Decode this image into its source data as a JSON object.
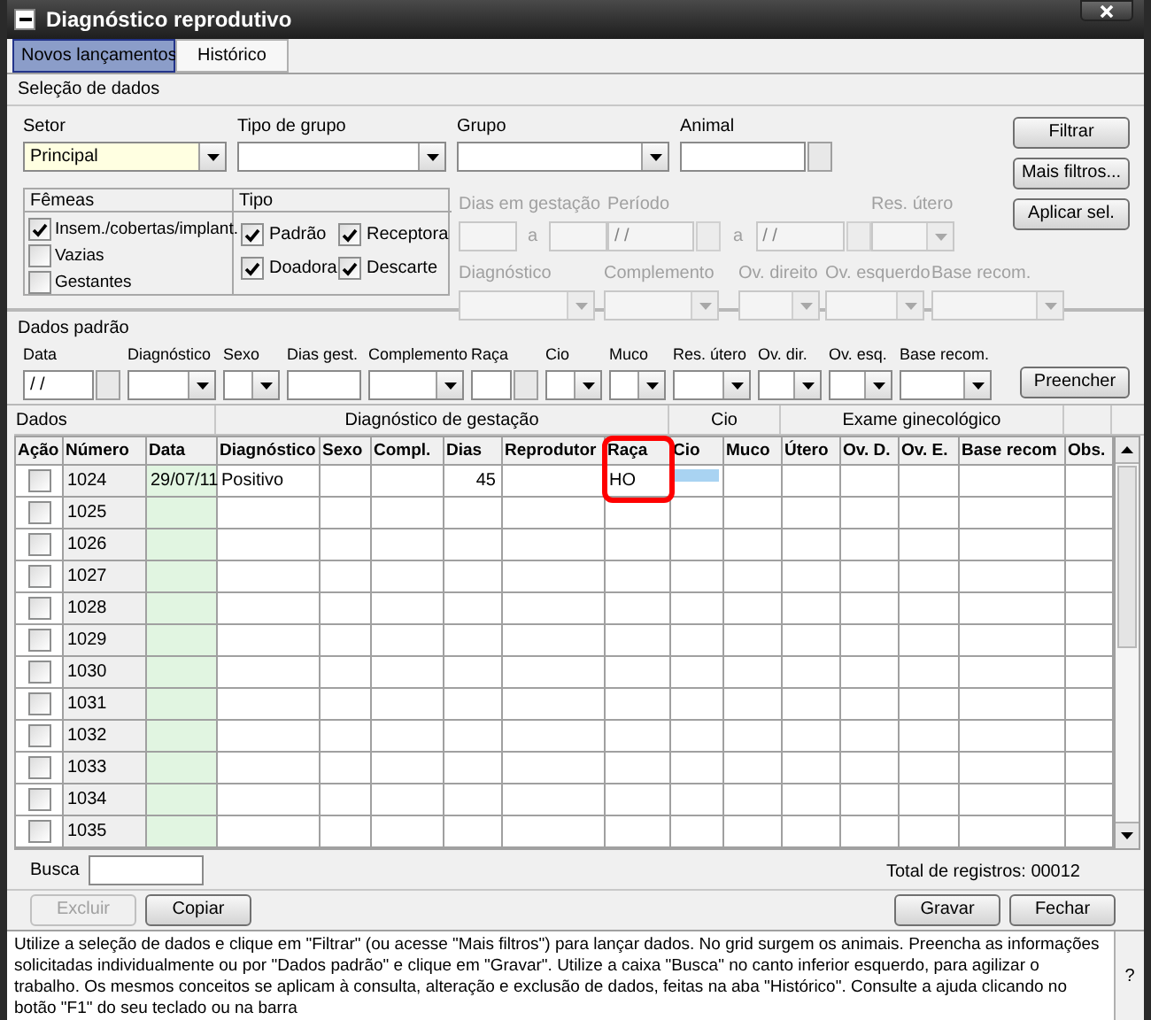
{
  "window": {
    "title": "Diagnóstico reprodutivo"
  },
  "tabs": [
    {
      "label": "Novos lançamentos",
      "selected": true
    },
    {
      "label": "Histórico",
      "selected": false
    }
  ],
  "selection": {
    "title": "Seleção de dados",
    "fields": [
      {
        "label": "Setor",
        "kind": "combo",
        "value": "Principal",
        "focused": true
      },
      {
        "label": "Tipo de grupo",
        "kind": "combo",
        "focused": false
      },
      {
        "label": "Grupo",
        "kind": "combo",
        "focused": false
      },
      {
        "label": "Animal",
        "kind": "lookup",
        "focused": false
      }
    ],
    "femeas": {
      "title": "Fêmeas",
      "items": [
        {
          "label": "Insem./cobertas/implant.",
          "checked": true
        },
        {
          "label": "Vazias",
          "checked": false
        },
        {
          "label": "Gestantes",
          "checked": false
        }
      ]
    },
    "tipo": {
      "title": "Tipo",
      "items": [
        {
          "label": "Padrão",
          "checked": true
        },
        {
          "label": "Receptora",
          "checked": true
        },
        {
          "label": "Doadora",
          "checked": true
        },
        {
          "label": "Descarte",
          "checked": true
        }
      ]
    },
    "filters_row_1": [
      {
        "label": "Dias em gestação",
        "kind": "text_range",
        "separator": "a",
        "disabled": true
      },
      {
        "label": "Período",
        "kind": "date_range",
        "value": "/ /",
        "value_to": "/ /",
        "separator": "a",
        "disabled": true
      },
      {
        "label": "Res. útero",
        "kind": "combo",
        "disabled": true
      }
    ],
    "filters_row_2": [
      {
        "label": "Diagnóstico",
        "kind": "combo",
        "disabled": true
      },
      {
        "label": "Complemento",
        "kind": "combo",
        "disabled": true
      },
      {
        "label": "Ov. direito",
        "kind": "combo",
        "disabled": true
      },
      {
        "label": "Ov. esquerdo",
        "kind": "combo",
        "disabled": true
      },
      {
        "label": "Base recom.",
        "kind": "combo",
        "disabled": true
      }
    ],
    "buttons": [
      {
        "label": "Filtrar"
      },
      {
        "label": "Mais filtros..."
      },
      {
        "label": "Aplicar sel."
      }
    ]
  },
  "defaults": {
    "title": "Dados padrão",
    "fields": [
      {
        "label": "Data",
        "kind": "date",
        "value": "/ /"
      },
      {
        "label": "Diagnóstico",
        "kind": "combo"
      },
      {
        "label": "Sexo",
        "kind": "combo"
      },
      {
        "label": "Dias gest.",
        "kind": "text"
      },
      {
        "label": "Complemento",
        "kind": "combo"
      },
      {
        "label": "Raça",
        "kind": "lookup"
      },
      {
        "label": "Cio",
        "kind": "combo"
      },
      {
        "label": "Muco",
        "kind": "combo"
      },
      {
        "label": "Res. útero",
        "kind": "combo"
      },
      {
        "label": "Ov. dir.",
        "kind": "combo"
      },
      {
        "label": "Ov. esq.",
        "kind": "combo"
      },
      {
        "label": "Base recom.",
        "kind": "combo"
      }
    ],
    "button": "Preencher"
  },
  "grid": {
    "title": "Dados",
    "groups": [
      {
        "columns": [
          {
            "label": "Ação",
            "circled": false
          },
          {
            "label": "Número",
            "circled": false
          },
          {
            "label": "Data",
            "circled": false
          }
        ]
      },
      {
        "label": "Diagnóstico de gestação",
        "columns": [
          {
            "label": "Diagnóstico",
            "circled": false
          },
          {
            "label": "Sexo",
            "circled": false
          },
          {
            "label": "Compl.",
            "circled": false
          },
          {
            "label": "Dias",
            "circled": false
          },
          {
            "label": "Reprodutor",
            "circled": false
          },
          {
            "label": "Raça",
            "circled": true
          }
        ]
      },
      {
        "label": "Cio",
        "columns": [
          {
            "label": "Cio",
            "circled": false
          },
          {
            "label": "Muco",
            "circled": false
          }
        ]
      },
      {
        "label": "Exame ginecológico",
        "columns": [
          {
            "label": "Útero",
            "circled": false
          },
          {
            "label": "Ov. D.",
            "circled": false
          },
          {
            "label": "Ov. E.",
            "circled": false
          },
          {
            "label": "Base recom",
            "circled": false
          }
        ]
      },
      {
        "columns": [
          {
            "label": "Obs.",
            "circled": false
          }
        ]
      }
    ],
    "rows": [
      {
        "checked": false,
        "number": "1024",
        "date": "29/07/11",
        "diagnosis": "Positivo",
        "days": "45",
        "breed": "HO",
        "cio_selected": true
      },
      {
        "checked": false,
        "number": "1025",
        "cio_selected": false
      },
      {
        "checked": false,
        "number": "1026",
        "cio_selected": false
      },
      {
        "checked": false,
        "number": "1027",
        "cio_selected": false
      },
      {
        "checked": false,
        "number": "1028",
        "cio_selected": false
      },
      {
        "checked": false,
        "number": "1029",
        "cio_selected": false
      },
      {
        "checked": false,
        "number": "1030",
        "cio_selected": false
      },
      {
        "checked": false,
        "number": "1031",
        "cio_selected": false
      },
      {
        "checked": false,
        "number": "1032",
        "cio_selected": false
      },
      {
        "checked": false,
        "number": "1033",
        "cio_selected": false
      },
      {
        "checked": false,
        "number": "1034",
        "cio_selected": false
      },
      {
        "checked": false,
        "number": "1035",
        "cio_selected": false
      }
    ]
  },
  "search": {
    "label": "Busca"
  },
  "total": "Total de registros: 00012",
  "left_buttons": [
    {
      "label": "Excluir",
      "disabled": true
    },
    {
      "label": "Copiar",
      "disabled": false
    }
  ],
  "right_buttons": [
    {
      "label": "Gravar",
      "disabled": false
    },
    {
      "label": "Fechar",
      "disabled": false
    }
  ],
  "help": {
    "text": "Utilize a seleção de dados e clique em \"Filtrar\" (ou acesse \"Mais filtros\") para lançar dados. No grid surgem os animais. Preencha as informações solicitadas individualmente ou por \"Dados padrão\" e clique em  \"Gravar\". Utilize a caixa \"Busca\" no canto inferior esquerdo, para agilizar o trabalho. Os mesmos conceitos se aplicam à consulta, alteração e exclusão de dados, feitas na aba \"Histórico\". Consulte a ajuda clicando no botão \"F1\" do seu teclado ou na barra",
    "button": "?"
  }
}
